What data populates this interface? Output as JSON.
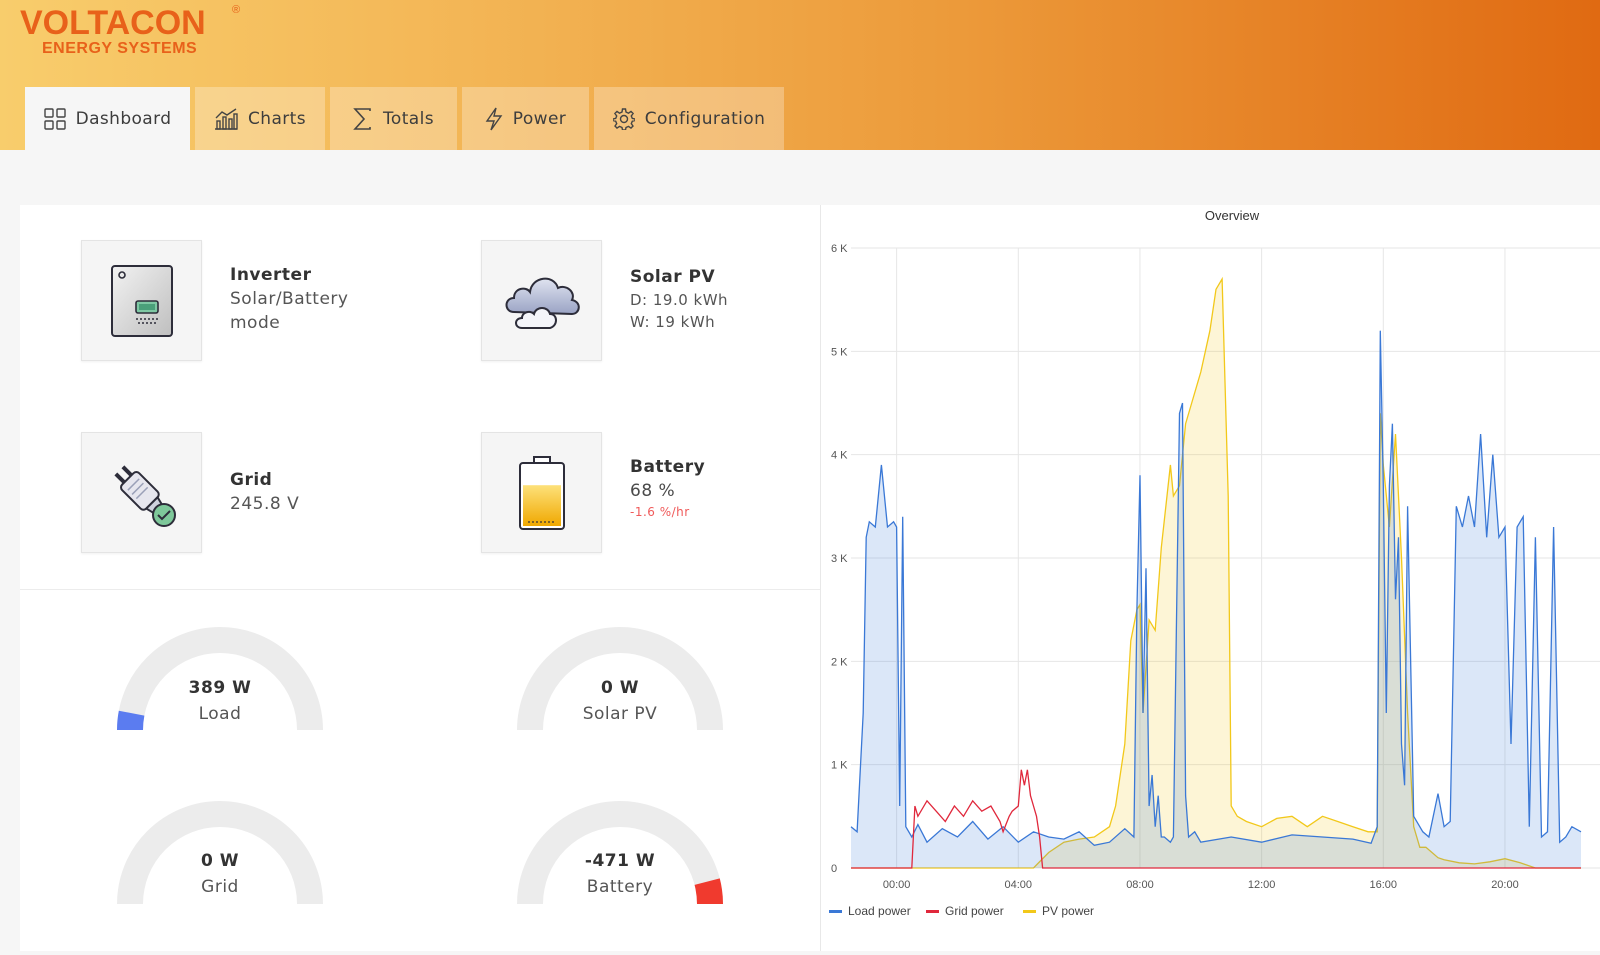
{
  "brand": {
    "name": "VOLTACON",
    "registered": "®",
    "tagline": "ENERGY SYSTEMS"
  },
  "tabs": [
    {
      "label": "Dashboard",
      "icon": "grid-icon",
      "active": true
    },
    {
      "label": "Charts",
      "icon": "chart-icon",
      "active": false
    },
    {
      "label": "Totals",
      "icon": "sigma-icon",
      "active": false
    },
    {
      "label": "Power",
      "icon": "bolt-icon",
      "active": false
    },
    {
      "label": "Configuration",
      "icon": "gear-icon",
      "active": false
    }
  ],
  "status": {
    "inverter": {
      "title": "Inverter",
      "line1": "Solar/Battery",
      "line2": "mode",
      "icon": "inverter-icon"
    },
    "solar": {
      "title": "Solar PV",
      "line1": "D: 19.0 kWh",
      "line2": "W: 19 kWh",
      "icon": "cloud-icon"
    },
    "grid": {
      "title": "Grid",
      "line1": "245.8 V",
      "icon": "plug-check-icon"
    },
    "battery": {
      "title": "Battery",
      "line1": "68 %",
      "line2": "-1.6 %/hr",
      "level": 0.68,
      "icon": "battery-icon"
    }
  },
  "gauges": [
    {
      "value": "389 W",
      "label": "Load",
      "fraction": 0.06,
      "color": "#5b7cf0",
      "side": "min"
    },
    {
      "value": "0 W",
      "label": "Solar PV",
      "fraction": 0,
      "color": "#5b7cf0",
      "side": "min"
    },
    {
      "value": "0 W",
      "label": "Grid",
      "fraction": 0,
      "color": "#5b7cf0",
      "side": "min"
    },
    {
      "value": "-471 W",
      "label": "Battery",
      "fraction": 0.08,
      "color": "#f03a2e",
      "side": "max"
    }
  ],
  "chart_data": {
    "type": "area",
    "title": "Overview",
    "xlabel": "",
    "ylabel": "",
    "x_ticks": [
      "00:00",
      "04:00",
      "08:00",
      "12:00",
      "16:00",
      "20:00"
    ],
    "y_ticks": [
      "0",
      "1 K",
      "2 K",
      "3 K",
      "4 K",
      "5 K",
      "6 K"
    ],
    "xlim": [
      -1.5,
      22.5
    ],
    "ylim": [
      0,
      6000
    ],
    "grid": true,
    "legend_position": "bottom-left",
    "series": [
      {
        "name": "Load power",
        "color": "#3a78d6",
        "x": [
          -1.5,
          -1.3,
          -1.1,
          -1.0,
          -0.9,
          -0.7,
          -0.5,
          -0.3,
          -0.1,
          0.0,
          0.1,
          0.2,
          0.3,
          0.5,
          0.7,
          1.0,
          1.5,
          2.0,
          2.5,
          3.0,
          3.5,
          4.0,
          4.5,
          5.0,
          5.5,
          6.0,
          6.5,
          7.0,
          7.5,
          7.8,
          7.9,
          8.0,
          8.1,
          8.2,
          8.3,
          8.4,
          8.5,
          8.6,
          8.7,
          8.8,
          9.0,
          9.1,
          9.2,
          9.3,
          9.4,
          9.5,
          9.6,
          9.8,
          10.0,
          11.0,
          12.0,
          13.0,
          14.0,
          15.0,
          15.6,
          15.8,
          15.9,
          16.0,
          16.1,
          16.2,
          16.3,
          16.4,
          16.5,
          16.6,
          16.7,
          16.8,
          17.0,
          17.2,
          17.3,
          17.5,
          17.8,
          18.0,
          18.2,
          18.4,
          18.6,
          18.8,
          19.0,
          19.2,
          19.4,
          19.6,
          19.8,
          20.0,
          20.2,
          20.4,
          20.6,
          20.8,
          21.0,
          21.2,
          21.4,
          21.6,
          21.8,
          22.0,
          22.2,
          22.5
        ],
        "y": [
          400,
          350,
          1500,
          3200,
          3350,
          3300,
          3900,
          3300,
          3350,
          3300,
          600,
          3400,
          400,
          300,
          420,
          250,
          380,
          300,
          450,
          280,
          400,
          250,
          350,
          300,
          280,
          350,
          220,
          250,
          380,
          300,
          2500,
          3800,
          1500,
          2900,
          600,
          900,
          400,
          700,
          300,
          300,
          250,
          300,
          2400,
          4400,
          4500,
          700,
          300,
          350,
          250,
          300,
          250,
          320,
          300,
          280,
          240,
          400,
          5200,
          3700,
          1500,
          3700,
          4300,
          2600,
          3200,
          1200,
          800,
          3500,
          500,
          400,
          350,
          300,
          720,
          400,
          450,
          3500,
          3300,
          3600,
          3300,
          4200,
          3200,
          4000,
          3200,
          3300,
          1200,
          3300,
          3400,
          400,
          3200,
          300,
          350,
          3300,
          250,
          300,
          400,
          350
        ],
        "fill": true
      },
      {
        "name": "Grid power",
        "color": "#e0283c",
        "x": [
          -1.5,
          0.4,
          0.5,
          0.6,
          0.7,
          1.0,
          1.3,
          1.6,
          1.9,
          2.2,
          2.5,
          2.8,
          3.1,
          3.4,
          3.5,
          3.7,
          3.8,
          4.0,
          4.1,
          4.2,
          4.3,
          4.4,
          4.5,
          4.6,
          4.7,
          4.8,
          22.5
        ],
        "y": [
          0,
          0,
          0,
          600,
          500,
          650,
          550,
          450,
          600,
          500,
          650,
          550,
          600,
          450,
          350,
          500,
          550,
          600,
          950,
          800,
          950,
          700,
          600,
          500,
          300,
          0,
          0
        ],
        "fill": false
      },
      {
        "name": "PV power",
        "color": "#f2c81a",
        "x": [
          -1.5,
          3.5,
          4.5,
          5.0,
          5.5,
          6.0,
          6.5,
          7.0,
          7.2,
          7.5,
          7.7,
          7.9,
          8.0,
          8.1,
          8.3,
          8.5,
          8.7,
          9.0,
          9.1,
          9.3,
          9.5,
          9.7,
          10.0,
          10.3,
          10.5,
          10.7,
          10.9,
          11.0,
          11.2,
          11.5,
          12.0,
          12.5,
          13.0,
          13.5,
          14.0,
          14.5,
          15.0,
          15.5,
          15.8,
          15.9,
          16.0,
          16.2,
          16.4,
          16.6,
          16.8,
          17.0,
          17.2,
          17.4,
          17.6,
          17.8,
          18.0,
          18.5,
          19.0,
          19.5,
          20.0,
          20.5,
          21.0,
          22.5
        ],
        "y": [
          0,
          0,
          0,
          150,
          250,
          280,
          300,
          400,
          600,
          1200,
          2200,
          2500,
          2550,
          1500,
          2400,
          2300,
          3100,
          3900,
          3600,
          3700,
          4300,
          4500,
          4800,
          5200,
          5600,
          5700,
          3600,
          600,
          500,
          450,
          400,
          480,
          500,
          400,
          500,
          450,
          400,
          350,
          350,
          4400,
          3900,
          3300,
          4200,
          3000,
          1500,
          400,
          200,
          200,
          150,
          100,
          80,
          50,
          40,
          60,
          90,
          50,
          0,
          0
        ],
        "fill": true
      }
    ]
  }
}
